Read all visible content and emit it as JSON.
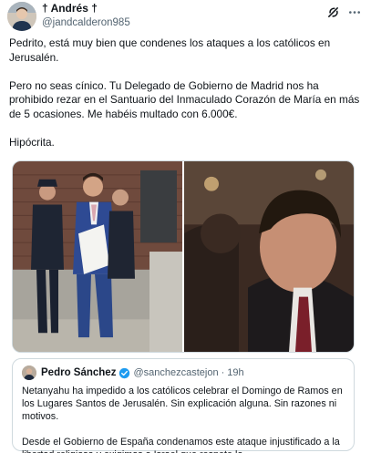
{
  "author": {
    "display_name": "† Andrés †",
    "handle": "@jandcalderon985"
  },
  "icons": {
    "avatar": "avatar",
    "grok": "grok-icon",
    "more": "more-icon",
    "verified": "verified-icon"
  },
  "tweet": {
    "paragraphs": [
      "Pedrito, está muy bien que condenes los ataques a los católicos en Jerusalén.",
      "Pero no seas cínico. Tu Delegado de Gobierno de Madrid nos ha prohibido rezar en el Santuario del Inmaculado Corazón de María en más de 5 ocasiones. Me habéis multado con 6.000€.",
      "Hipócrita."
    ]
  },
  "media": {
    "count": 2
  },
  "quote": {
    "display_name": "Pedro Sánchez",
    "handle": "@sanchezcastejon",
    "separator": "·",
    "time": "19h",
    "paragraphs": [
      "Netanyahu ha impedido a los católicos celebrar el Domingo de Ramos en los Lugares Santos de Jerusalén. Sin explicación alguna. Sin razones ni motivos.",
      "Desde el Gobierno de España condenamos este ataque injustificado a la libertad religiosa y exigimos a Israel que respete la"
    ]
  },
  "colors": {
    "text": "#0f1419",
    "secondary": "#536471",
    "border": "#cfd9de",
    "verified": "#1d9bf0"
  }
}
